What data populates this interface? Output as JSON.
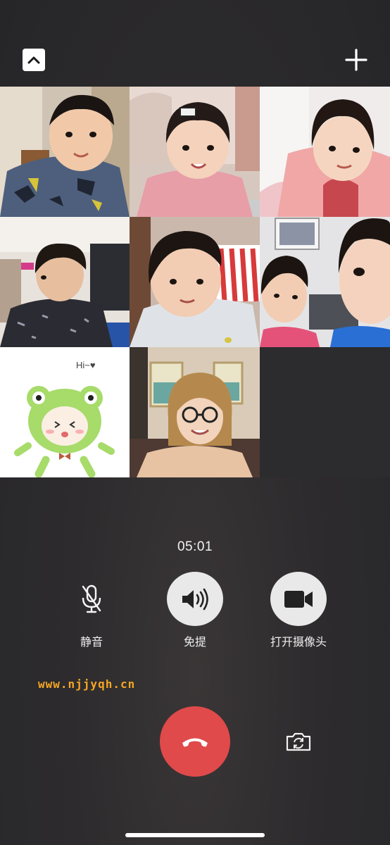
{
  "call": {
    "duration": "05:01",
    "watermark": "www.njjyqh.cn"
  },
  "icons": {
    "collapse": "chevron-up-icon",
    "add_member": "plus-icon",
    "mute": "microphone-icon",
    "speaker": "speaker-icon",
    "camera": "video-camera-icon",
    "hangup": "phone-hangup-icon",
    "flip_camera": "camera-flip-icon"
  },
  "controls": {
    "mute_label": "静音",
    "speaker_label": "免提",
    "camera_label": "打开摄像头"
  },
  "participants": {
    "sticker_text": "Hi~♥"
  },
  "colors": {
    "background": "#2d2b2d",
    "hangup": "#e04a4a",
    "button_light": "#e9e9e9",
    "watermark": "#f5a623"
  }
}
